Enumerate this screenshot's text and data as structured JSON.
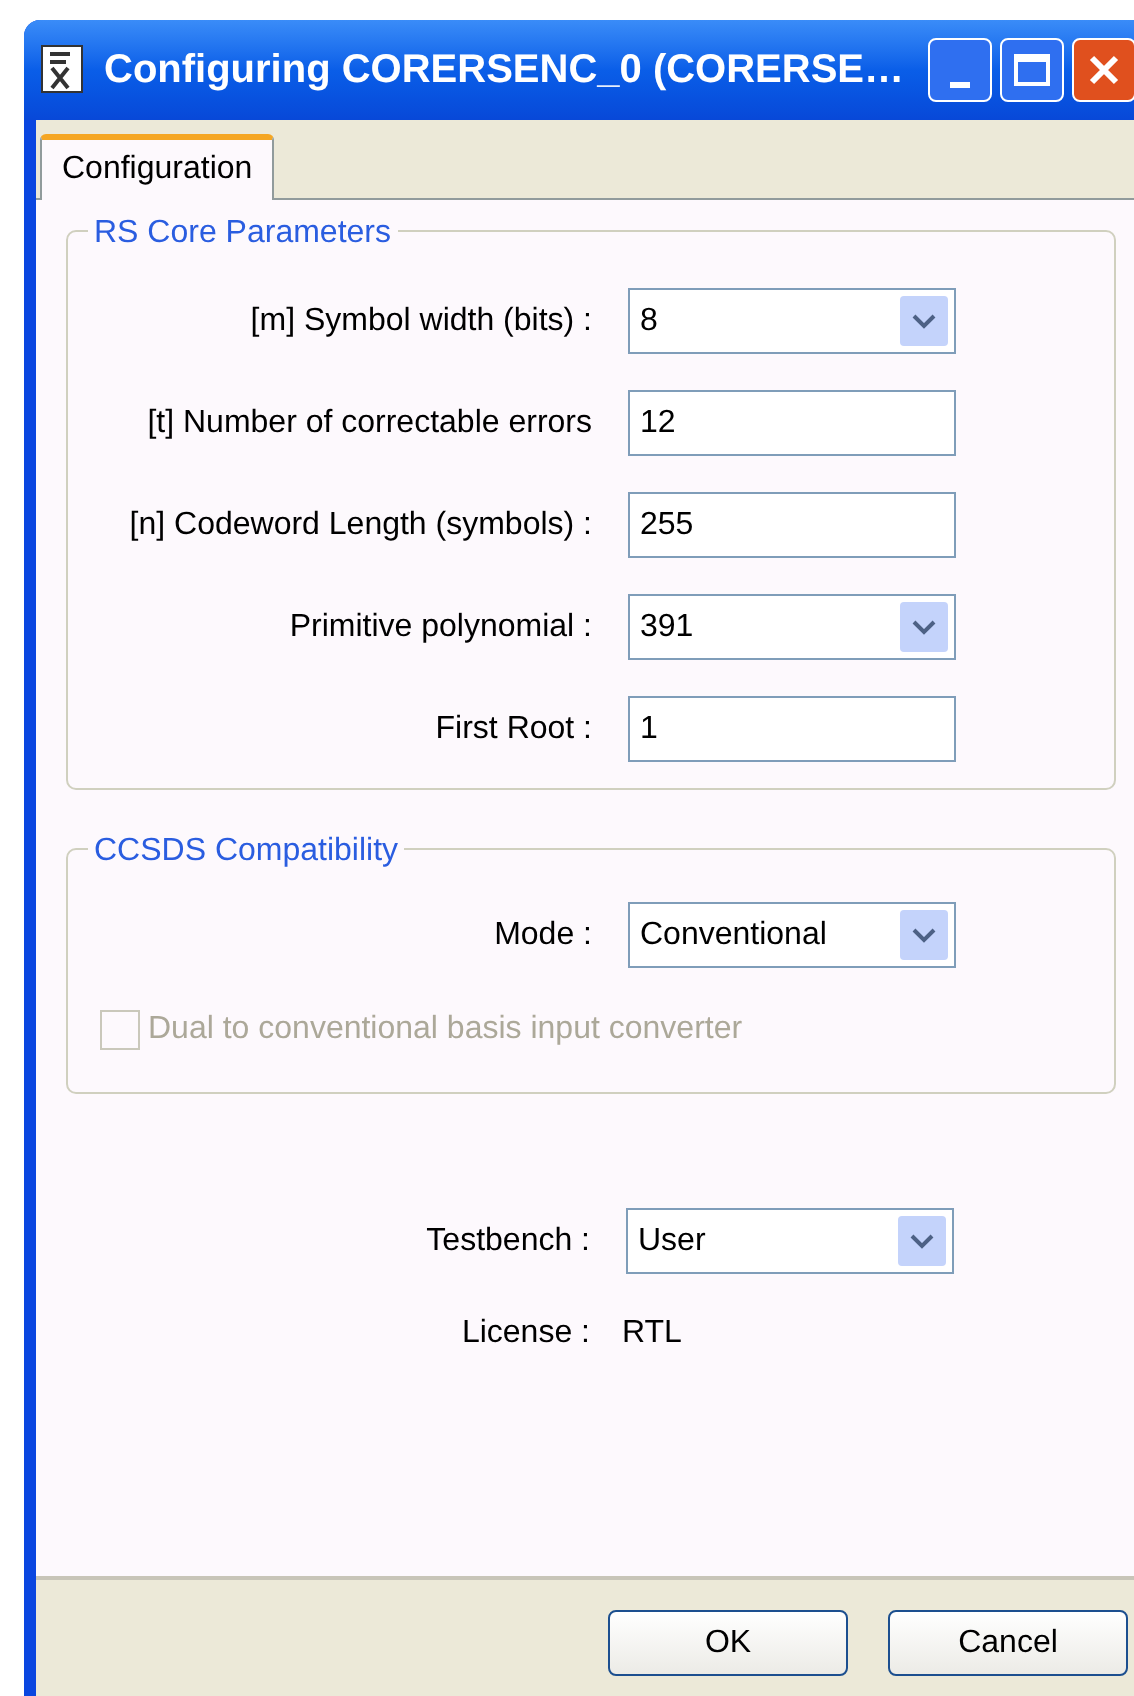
{
  "window": {
    "title": "Configuring CORERSENC_0 (CORERSE…"
  },
  "tabs": [
    {
      "label": "Configuration",
      "selected": true
    }
  ],
  "groups": [
    {
      "title": "RS Core Parameters",
      "fields": [
        {
          "kind": "dropdown",
          "label": "[m] Symbol width (bits) :",
          "value": "8"
        },
        {
          "kind": "text",
          "label": "[t] Number of correctable errors",
          "value": "12"
        },
        {
          "kind": "text",
          "label": "[n] Codeword Length (symbols) :",
          "value": "255"
        },
        {
          "kind": "dropdown",
          "label": "Primitive polynomial :",
          "value": "391"
        },
        {
          "kind": "text",
          "label": "First Root :",
          "value": "1"
        }
      ]
    },
    {
      "title": "CCSDS Compatibility",
      "fields": [
        {
          "kind": "dropdown",
          "label": "Mode :",
          "value": "Conventional"
        },
        {
          "kind": "checkbox",
          "label": "Dual to conventional basis input converter",
          "checked": false,
          "disabled": true
        }
      ]
    }
  ],
  "testbench": {
    "label": "Testbench :",
    "value": "User"
  },
  "license": {
    "label": "License :",
    "value": "RTL"
  },
  "buttons": [
    "OK",
    "Cancel"
  ]
}
